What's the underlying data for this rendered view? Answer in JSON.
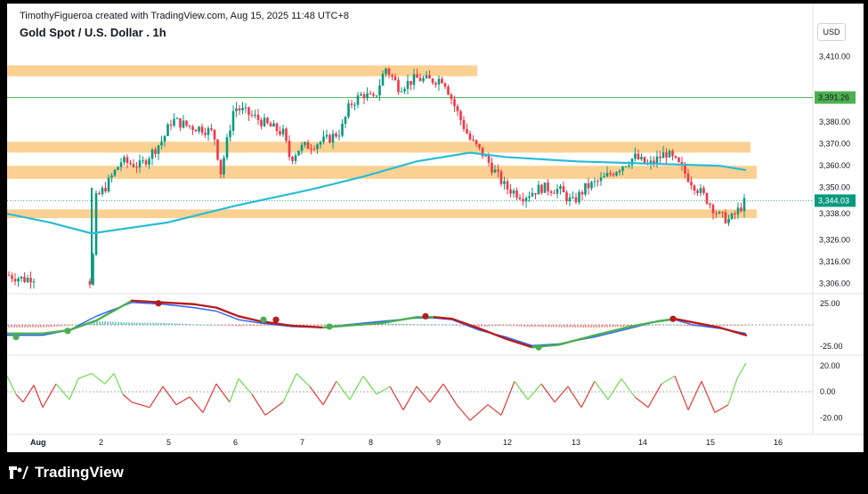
{
  "header": {
    "credit": "TimothyFigueroa created with TradingView.com, Aug 15, 2025 11:48 UTC+8",
    "title": "Gold Spot / U.S. Dollar . 1h",
    "currency": "USD"
  },
  "brand": {
    "name": "TradingView"
  },
  "colors": {
    "zone": "#fbd193",
    "ema": "#2bbcd4",
    "bull": "#089981",
    "bear": "#f23645",
    "macd_fast": "#2962ff",
    "macd_signal_up": "#4caf50",
    "macd_signal_down": "#b71c1c",
    "osc_up": "#6ddb4c",
    "osc_down": "#e53935",
    "hline": "#4caf50"
  },
  "chart_data": [
    {
      "type": "candlestick",
      "title": "Gold Spot / U.S. Dollar . 1h",
      "x_tick_labels": [
        "Aug",
        "2",
        "5",
        "6",
        "7",
        "8",
        "9",
        "12",
        "13",
        "14",
        "15",
        "16"
      ],
      "y_tick_labels": [
        "3,410.00",
        "3,380.00",
        "3,370.00",
        "3,360.00",
        "3,350.00",
        "3,338.00",
        "3,326.00",
        "3,316.00",
        "3,306.00"
      ],
      "ylim": [
        3303,
        3418
      ],
      "price_labels": [
        {
          "value": 3391.26,
          "text": "3,391.26",
          "kind": "horizontal-line"
        },
        {
          "value": 3344.03,
          "text": "3,344.03",
          "kind": "last-price"
        }
      ],
      "zones": [
        {
          "from": 3401,
          "to": 3406
        },
        {
          "from": 3366,
          "to": 3371
        },
        {
          "from": 3354,
          "to": 3360
        },
        {
          "from": 3336,
          "to": 3340
        }
      ],
      "series": [
        {
          "type": "line",
          "role": "moving-average",
          "points": [
            [
              0,
              3338
            ],
            [
              48,
              3334
            ],
            [
              95,
              3329
            ],
            [
              180,
              3334
            ],
            [
              260,
              3342
            ],
            [
              340,
              3349
            ],
            [
              400,
              3355
            ],
            [
              460,
              3362
            ],
            [
              520,
              3366
            ],
            [
              560,
              3364
            ],
            [
              640,
              3362
            ],
            [
              720,
              3361
            ],
            [
              800,
              3360
            ],
            [
              830,
              3358
            ]
          ]
        }
      ],
      "price_path": [
        [
          0,
          3310
        ],
        [
          20,
          3308
        ],
        [
          28,
          3309
        ],
        [
          95,
          3307
        ],
        [
          100,
          3345
        ],
        [
          110,
          3350
        ],
        [
          128,
          3362
        ],
        [
          150,
          3360
        ],
        [
          175,
          3372
        ],
        [
          185,
          3381
        ],
        [
          205,
          3378
        ],
        [
          220,
          3377
        ],
        [
          232,
          3375
        ],
        [
          240,
          3357
        ],
        [
          255,
          3387
        ],
        [
          275,
          3383
        ],
        [
          295,
          3378
        ],
        [
          310,
          3375
        ],
        [
          318,
          3363
        ],
        [
          328,
          3368
        ],
        [
          345,
          3370
        ],
        [
          360,
          3372
        ],
        [
          375,
          3376
        ],
        [
          385,
          3388
        ],
        [
          400,
          3393
        ],
        [
          412,
          3390
        ],
        [
          425,
          3405
        ],
        [
          440,
          3396
        ],
        [
          460,
          3400
        ],
        [
          475,
          3399
        ],
        [
          490,
          3400
        ],
        [
          505,
          3385
        ],
        [
          520,
          3372
        ],
        [
          535,
          3365
        ],
        [
          545,
          3359
        ],
        [
          560,
          3350
        ],
        [
          580,
          3346
        ],
        [
          600,
          3350
        ],
        [
          620,
          3349
        ],
        [
          635,
          3343
        ],
        [
          650,
          3350
        ],
        [
          670,
          3354
        ],
        [
          690,
          3360
        ],
        [
          705,
          3364
        ],
        [
          720,
          3360
        ],
        [
          740,
          3366
        ],
        [
          755,
          3360
        ],
        [
          770,
          3352
        ],
        [
          785,
          3345
        ],
        [
          800,
          3337
        ],
        [
          812,
          3335
        ],
        [
          822,
          3340
        ],
        [
          830,
          3344
        ]
      ],
      "x_range": [
        0,
        910
      ]
    },
    {
      "type": "line",
      "role": "macd",
      "y_tick_labels": [
        "25.00",
        "-25.00"
      ],
      "ylim": [
        -32,
        32
      ],
      "series": [
        {
          "role": "macd-line",
          "points": [
            [
              0,
              -12
            ],
            [
              40,
              -12
            ],
            [
              70,
              -6
            ],
            [
              100,
              10
            ],
            [
              140,
              26
            ],
            [
              175,
              24
            ],
            [
              210,
              20
            ],
            [
              235,
              16
            ],
            [
              260,
              6
            ],
            [
              285,
              2
            ],
            [
              320,
              -2
            ],
            [
              355,
              -3
            ],
            [
              380,
              0
            ],
            [
              420,
              4
            ],
            [
              460,
              8
            ],
            [
              480,
              8
            ],
            [
              500,
              6
            ],
            [
              530,
              -6
            ],
            [
              560,
              -14
            ],
            [
              590,
              -24
            ],
            [
              620,
              -22
            ],
            [
              660,
              -14
            ],
            [
              700,
              -4
            ],
            [
              730,
              4
            ],
            [
              750,
              6
            ],
            [
              770,
              0
            ],
            [
              800,
              -4
            ],
            [
              830,
              -10
            ]
          ]
        },
        {
          "role": "signal-line",
          "points": [
            [
              0,
              -10
            ],
            [
              40,
              -10
            ],
            [
              70,
              -6
            ],
            [
              100,
              5
            ],
            [
              140,
              28
            ],
            [
              175,
              26
            ],
            [
              210,
              24
            ],
            [
              235,
              20
            ],
            [
              260,
              10
            ],
            [
              285,
              4
            ],
            [
              320,
              -1
            ],
            [
              355,
              -3
            ],
            [
              380,
              -1
            ],
            [
              420,
              2
            ],
            [
              460,
              9
            ],
            [
              480,
              9
            ],
            [
              500,
              7
            ],
            [
              530,
              -4
            ],
            [
              560,
              -16
            ],
            [
              590,
              -26
            ],
            [
              620,
              -23
            ],
            [
              660,
              -12
            ],
            [
              700,
              -2
            ],
            [
              730,
              4
            ],
            [
              750,
              7
            ],
            [
              770,
              3
            ],
            [
              800,
              -3
            ],
            [
              830,
              -12
            ]
          ]
        }
      ],
      "crossings": [
        [
          10,
          -14
        ],
        [
          68,
          -7
        ],
        [
          170,
          25
        ],
        [
          288,
          6
        ],
        [
          302,
          6
        ],
        [
          362,
          -2
        ],
        [
          470,
          10
        ],
        [
          597,
          -26
        ],
        [
          748,
          7
        ]
      ]
    },
    {
      "type": "line",
      "role": "oscillator",
      "y_tick_labels": [
        "20.00",
        "0.00",
        "-20.00"
      ],
      "ylim": [
        -30,
        26
      ],
      "series": [
        {
          "role": "oscillator-line",
          "points": [
            [
              0,
              12
            ],
            [
              10,
              -2
            ],
            [
              18,
              -8
            ],
            [
              30,
              5
            ],
            [
              40,
              -12
            ],
            [
              55,
              6
            ],
            [
              70,
              -6
            ],
            [
              80,
              10
            ],
            [
              95,
              14
            ],
            [
              110,
              6
            ],
            [
              120,
              14
            ],
            [
              130,
              -2
            ],
            [
              140,
              -8
            ],
            [
              160,
              -12
            ],
            [
              175,
              4
            ],
            [
              190,
              -10
            ],
            [
              205,
              -4
            ],
            [
              220,
              -16
            ],
            [
              235,
              6
            ],
            [
              250,
              -8
            ],
            [
              260,
              10
            ],
            [
              275,
              -2
            ],
            [
              290,
              -18
            ],
            [
              310,
              -8
            ],
            [
              325,
              14
            ],
            [
              340,
              4
            ],
            [
              355,
              -10
            ],
            [
              370,
              8
            ],
            [
              385,
              -6
            ],
            [
              400,
              12
            ],
            [
              415,
              -2
            ],
            [
              430,
              4
            ],
            [
              445,
              -14
            ],
            [
              460,
              4
            ],
            [
              475,
              -8
            ],
            [
              490,
              6
            ],
            [
              505,
              -10
            ],
            [
              520,
              -22
            ],
            [
              540,
              -10
            ],
            [
              555,
              -18
            ],
            [
              570,
              8
            ],
            [
              585,
              -6
            ],
            [
              600,
              6
            ],
            [
              615,
              -8
            ],
            [
              630,
              4
            ],
            [
              645,
              -12
            ],
            [
              660,
              8
            ],
            [
              675,
              -6
            ],
            [
              690,
              10
            ],
            [
              705,
              -4
            ],
            [
              720,
              -12
            ],
            [
              735,
              6
            ],
            [
              750,
              12
            ],
            [
              765,
              -14
            ],
            [
              780,
              8
            ],
            [
              795,
              -16
            ],
            [
              810,
              -10
            ],
            [
              820,
              10
            ],
            [
              830,
              22
            ]
          ]
        }
      ]
    }
  ]
}
